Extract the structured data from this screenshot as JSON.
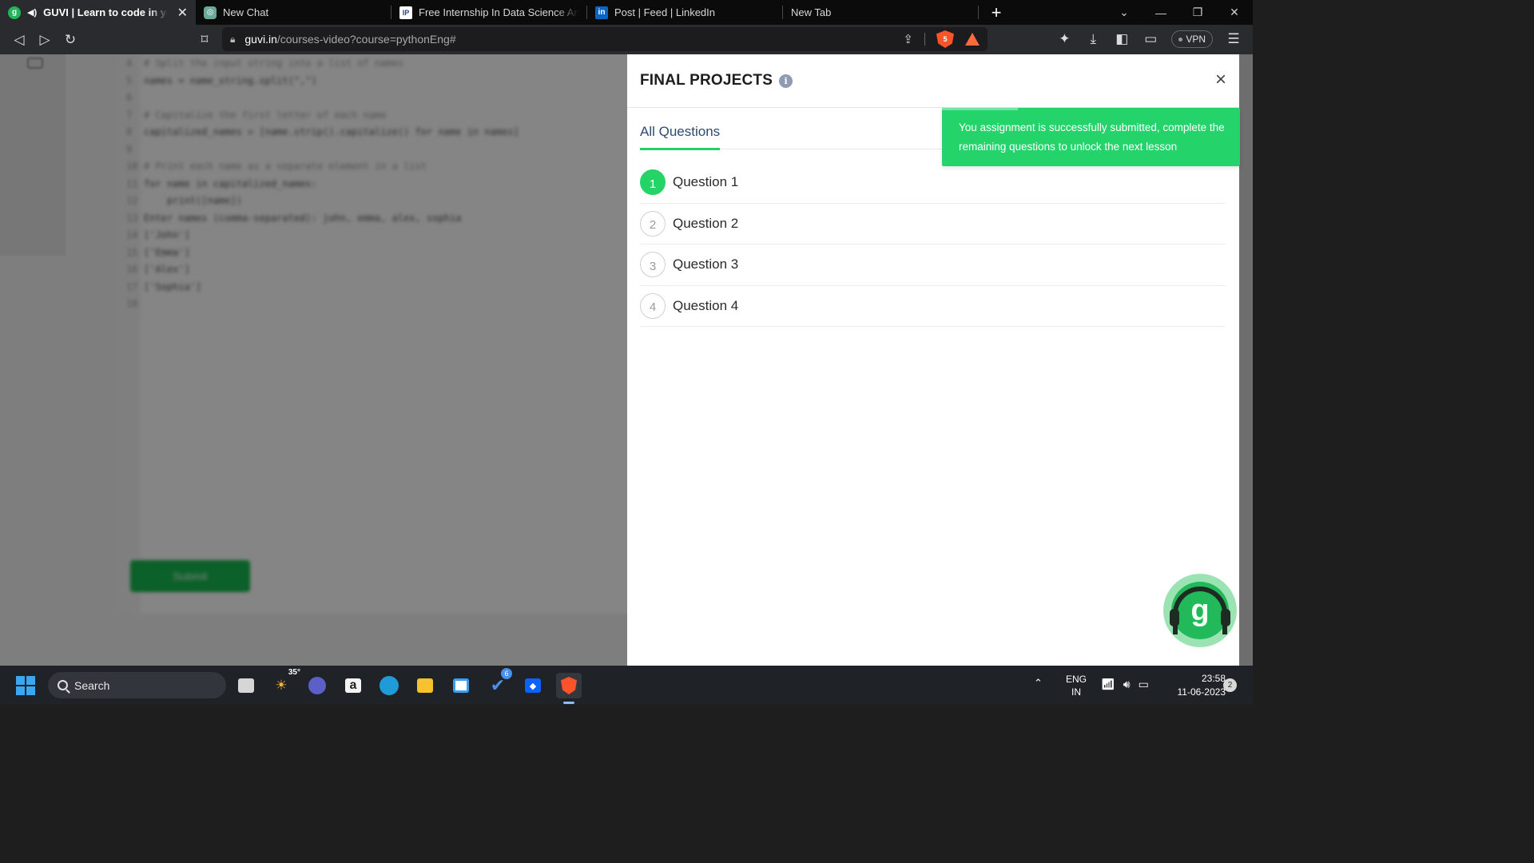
{
  "browser": {
    "tabs": [
      {
        "title": "GUVI | Learn to code in your native language",
        "favicon": "guvi-icon",
        "active": true
      },
      {
        "title": "New Chat",
        "favicon": "chat-icon",
        "active": false
      },
      {
        "title": "Free Internship In Data Science And Machine Learning",
        "favicon": "internship-icon",
        "active": false
      },
      {
        "title": "Post | Feed | LinkedIn",
        "favicon": "linkedin-icon",
        "active": false
      },
      {
        "title": "New Tab",
        "favicon": "",
        "active": false
      }
    ],
    "url_host": "guvi.in",
    "url_path": "/courses-video?course=pythonEng#",
    "shield_count": "5",
    "vpn_label": "VPN"
  },
  "editor": {
    "lines": [
      {
        "n": "4",
        "text": "# Split the input string into a list of names"
      },
      {
        "n": "5",
        "text": "names = name_string.split(\",\")"
      },
      {
        "n": "6",
        "text": ""
      },
      {
        "n": "7",
        "text": "# Capitalize the first letter of each name"
      },
      {
        "n": "8",
        "text": "capitalized_names = [name.strip().capitalize() for name in names]"
      },
      {
        "n": "9",
        "text": ""
      },
      {
        "n": "10",
        "text": "# Print each name as a separate element in a list"
      },
      {
        "n": "11",
        "text": "for name in capitalized_names:"
      },
      {
        "n": "12",
        "text": "    print([name])"
      },
      {
        "n": "13",
        "text": "Enter names (comma-separated): john, emma, alex, sophia"
      },
      {
        "n": "14",
        "text": "['John']"
      },
      {
        "n": "15",
        "text": "['Emma']"
      },
      {
        "n": "16",
        "text": "['Alex']"
      },
      {
        "n": "17",
        "text": "['Sophia']"
      },
      {
        "n": "18",
        "text": ""
      }
    ],
    "submit_label": "Submit"
  },
  "drawer": {
    "title": "FINAL PROJECTS",
    "info_glyph": "i",
    "close_glyph": "×",
    "tab_label": "All Questions",
    "questions": [
      {
        "num": "1",
        "label": "Question 1",
        "completed": true
      },
      {
        "num": "2",
        "label": "Question 2",
        "completed": false
      },
      {
        "num": "3",
        "label": "Question 3",
        "completed": false
      },
      {
        "num": "4",
        "label": "Question 4",
        "completed": false
      }
    ]
  },
  "toast": {
    "message": "You assignment is successfully submitted, complete the remaining questions to unlock the next lesson"
  },
  "taskbar": {
    "search_label": "Search",
    "weather_temp": "35°",
    "todo_badge": "6",
    "lang_top": "ENG",
    "lang_bottom": "IN",
    "time": "23:58",
    "date": "11-06-2023",
    "notification_count": "2"
  },
  "colors": {
    "accent_green": "#25d366",
    "toast_green": "#25d36b",
    "tab_underline": "#25d06b"
  }
}
